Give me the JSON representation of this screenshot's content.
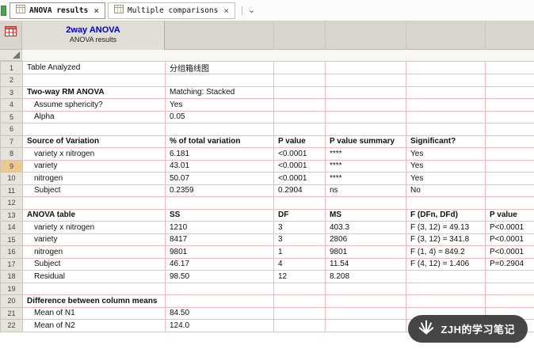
{
  "tab_bar": {
    "tabs": [
      {
        "label": "ANOVA results",
        "close_icon": "×"
      },
      {
        "label": "Multiple comparisons",
        "close_icon": "×"
      }
    ],
    "divider": "|",
    "dropdown_icon": "⌄"
  },
  "sheet_header": {
    "title": "2way ANOVA",
    "subtitle": "ANOVA results"
  },
  "colors": {
    "title_blue": "#0000cc",
    "grid_line_red": "#f3bcbc",
    "header_band_bg": "#d8d5cc",
    "row_number_bg": "#e6e3db",
    "selected_row_number_bg": "#eec88e",
    "watermark_bg": "#383838",
    "partial_tab_green": "#3fae49"
  },
  "table": {
    "selected_row": "9",
    "rows": [
      {
        "n": "1",
        "style": "normal",
        "indent": false,
        "cells": [
          "Table Analyzed",
          "分组箱线图",
          "",
          "",
          "",
          ""
        ]
      },
      {
        "n": "2",
        "style": "normal",
        "indent": false,
        "cells": [
          "",
          "",
          "",
          "",
          "",
          ""
        ]
      },
      {
        "n": "3",
        "style": "section",
        "indent": false,
        "cells": [
          "Two-way RM ANOVA",
          "Matching: Stacked",
          "",
          "",
          "",
          ""
        ]
      },
      {
        "n": "4",
        "style": "normal",
        "indent": true,
        "cells": [
          "Assume sphericity?",
          "Yes",
          "",
          "",
          "",
          ""
        ]
      },
      {
        "n": "5",
        "style": "normal",
        "indent": true,
        "cells": [
          "Alpha",
          "0.05",
          "",
          "",
          "",
          ""
        ]
      },
      {
        "n": "6",
        "style": "normal",
        "indent": false,
        "cells": [
          "",
          "",
          "",
          "",
          "",
          ""
        ]
      },
      {
        "n": "7",
        "style": "header",
        "indent": false,
        "cells": [
          "Source of Variation",
          "% of total variation",
          "P value",
          "P value summary",
          "Significant?",
          ""
        ]
      },
      {
        "n": "8",
        "style": "normal",
        "indent": true,
        "cells": [
          "variety x nitrogen",
          "6.181",
          "<0.0001",
          "****",
          "Yes",
          ""
        ]
      },
      {
        "n": "9",
        "style": "normal",
        "indent": true,
        "cells": [
          "variety",
          "43.01",
          "<0.0001",
          "****",
          "Yes",
          ""
        ]
      },
      {
        "n": "10",
        "style": "normal",
        "indent": true,
        "cells": [
          "nitrogen",
          "50.07",
          "<0.0001",
          "****",
          "Yes",
          ""
        ]
      },
      {
        "n": "11",
        "style": "normal",
        "indent": true,
        "cells": [
          "Subject",
          "0.2359",
          "0.2904",
          "ns",
          "No",
          ""
        ]
      },
      {
        "n": "12",
        "style": "normal",
        "indent": false,
        "cells": [
          "",
          "",
          "",
          "",
          "",
          ""
        ]
      },
      {
        "n": "13",
        "style": "header",
        "indent": false,
        "cells": [
          "ANOVA table",
          "SS",
          "DF",
          "MS",
          "F (DFn, DFd)",
          "P value"
        ]
      },
      {
        "n": "14",
        "style": "normal",
        "indent": true,
        "cells": [
          "variety x nitrogen",
          "1210",
          "3",
          "403.3",
          "F (3, 12) = 49.13",
          "P<0.0001"
        ]
      },
      {
        "n": "15",
        "style": "normal",
        "indent": true,
        "cells": [
          "variety",
          "8417",
          "3",
          "2806",
          "F (3, 12) = 341.8",
          "P<0.0001"
        ]
      },
      {
        "n": "16",
        "style": "normal",
        "indent": true,
        "cells": [
          "nitrogen",
          "9801",
          "1",
          "9801",
          "F (1, 4) = 849.2",
          "P<0.0001"
        ]
      },
      {
        "n": "17",
        "style": "normal",
        "indent": true,
        "cells": [
          "Subject",
          "46.17",
          "4",
          "11.54",
          "F (4, 12) = 1.406",
          "P=0.2904"
        ]
      },
      {
        "n": "18",
        "style": "normal",
        "indent": true,
        "cells": [
          "Residual",
          "98.50",
          "12",
          "8.208",
          "",
          ""
        ]
      },
      {
        "n": "19",
        "style": "normal",
        "indent": false,
        "cells": [
          "",
          "",
          "",
          "",
          "",
          ""
        ]
      },
      {
        "n": "20",
        "style": "section",
        "indent": false,
        "cells": [
          "Difference between column means",
          "",
          "",
          "",
          "",
          ""
        ]
      },
      {
        "n": "21",
        "style": "normal",
        "indent": true,
        "cells": [
          "Mean of N1",
          "84.50",
          "",
          "",
          "",
          ""
        ]
      },
      {
        "n": "22",
        "style": "normal",
        "indent": true,
        "cells": [
          "Mean of N2",
          "124.0",
          "",
          "",
          "",
          ""
        ]
      }
    ]
  },
  "watermark": {
    "text": "ZJH的学习笔记"
  }
}
